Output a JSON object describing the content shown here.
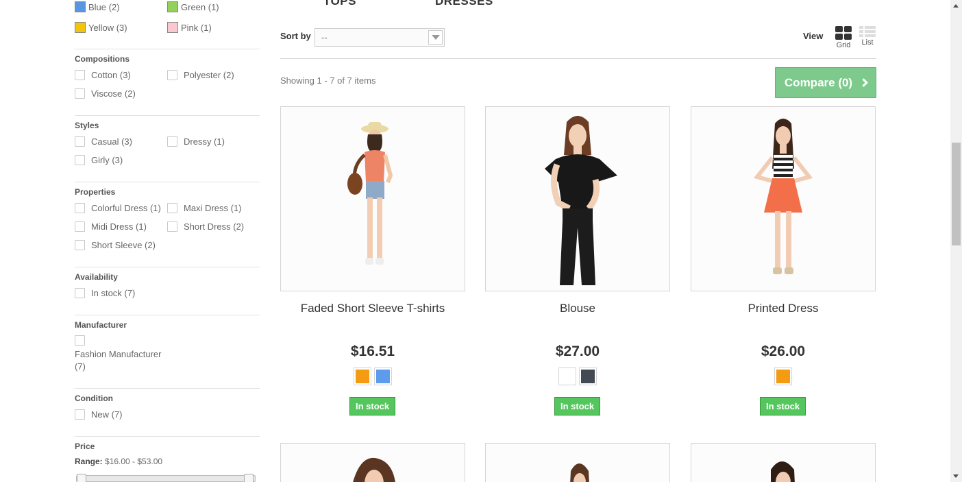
{
  "filters": {
    "colors": [
      {
        "label": "Blue (2)",
        "color": "#5896e3"
      },
      {
        "label": "Green (1)",
        "color": "#93d05c"
      },
      {
        "label": "Yellow (3)",
        "color": "#f1c40f"
      },
      {
        "label": "Pink (1)",
        "color": "#fcc8d0"
      }
    ],
    "compositions": {
      "title": "Compositions",
      "items": [
        "Cotton (3)",
        "Polyester (2)",
        "Viscose (2)"
      ]
    },
    "styles": {
      "title": "Styles",
      "items": [
        "Casual (3)",
        "Dressy (1)",
        "Girly (3)"
      ]
    },
    "properties": {
      "title": "Properties",
      "items": [
        "Colorful Dress (1)",
        "Maxi Dress (1)",
        "Midi Dress (1)",
        "Short Dress (2)",
        "Short Sleeve (2)"
      ]
    },
    "availability": {
      "title": "Availability",
      "items": [
        "In stock (7)"
      ]
    },
    "manufacturer": {
      "title": "Manufacturer",
      "line1": "Fashion Manufacturer",
      "line2": "(7)"
    },
    "condition": {
      "title": "Condition",
      "items": [
        "New (7)"
      ]
    },
    "price": {
      "title": "Price",
      "range_label": "Range:",
      "range_value": "$16.00 - $53.00"
    }
  },
  "category_tabs": [
    "TOPS",
    "DRESSES"
  ],
  "toolbar": {
    "sort_label": "Sort by",
    "sort_value": "--",
    "view_label": "View",
    "grid_label": "Grid",
    "list_label": "List",
    "showing": "Showing 1 - 7 of 7 items",
    "compare_label": "Compare (0)"
  },
  "products": [
    {
      "name": "Faded Short Sleeve T-shirts",
      "price": "$16.51",
      "colors": [
        "#f39c11",
        "#5d9cec"
      ],
      "stock": "In stock"
    },
    {
      "name": "Blouse",
      "price": "$27.00",
      "colors": [
        "#ffffff",
        "#434a54"
      ],
      "stock": "In stock"
    },
    {
      "name": "Printed Dress",
      "price": "$26.00",
      "colors": [
        "#f39c11"
      ],
      "stock": "In stock"
    }
  ]
}
